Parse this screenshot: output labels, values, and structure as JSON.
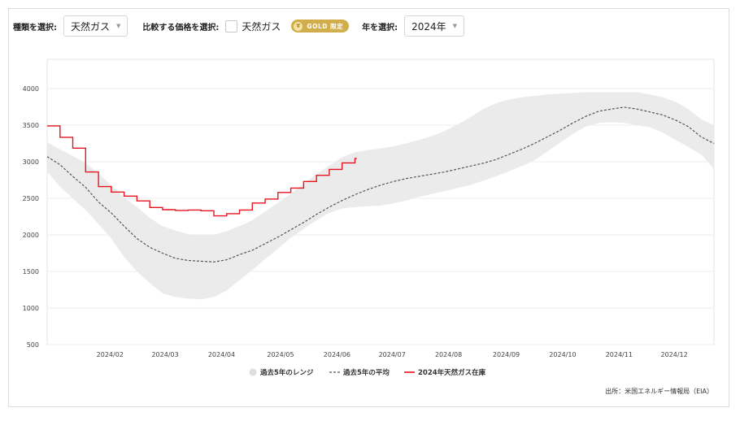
{
  "controls": {
    "type_label": "種類を選択:",
    "type_value": "天然ガス",
    "compare_label": "比較する価格を選択:",
    "compare_option": "天然ガス",
    "gold_badge": "GOLD 限定",
    "year_label": "年を選択:",
    "year_value": "2024年"
  },
  "source": "出所：米国エネルギー情報局（EIA）",
  "colors": {
    "inventory": "#e8141e",
    "average": "#555555",
    "range": "#ebebeb",
    "gold": "#d1ad4b"
  },
  "chart_data": {
    "type": "line",
    "title": "",
    "xlabel": "",
    "ylabel": "",
    "ylim": [
      500,
      4400
    ],
    "xlim": [
      1,
      53
    ],
    "yticks": [
      500,
      1000,
      1500,
      2000,
      2500,
      3000,
      3500,
      4000
    ],
    "xticks": [
      {
        "label": "2024/02",
        "x": 5.9
      },
      {
        "label": "2024/03",
        "x": 10.2
      },
      {
        "label": "2024/04",
        "x": 14.6
      },
      {
        "label": "2024/05",
        "x": 19.2
      },
      {
        "label": "2024/06",
        "x": 23.6
      },
      {
        "label": "2024/07",
        "x": 27.9
      },
      {
        "label": "2024/08",
        "x": 32.3
      },
      {
        "label": "2024/09",
        "x": 36.8
      },
      {
        "label": "2024/10",
        "x": 41.2
      },
      {
        "label": "2024/11",
        "x": 45.6
      },
      {
        "label": "2024/12",
        "x": 49.9
      }
    ],
    "grid": true,
    "legend_position": "bottom",
    "legend": [
      "過去5年のレンジ",
      "過去5年の平均",
      "2024年天然ガス在庫"
    ],
    "series": [
      {
        "name": "2024年天然ガス在庫",
        "style": "solid",
        "x": [
          1,
          2,
          3,
          4,
          5,
          6,
          7,
          8,
          9,
          10,
          11,
          12,
          13,
          14,
          15,
          16,
          17,
          18,
          19,
          20,
          21,
          22,
          23,
          24,
          25
        ],
        "values": [
          3490,
          3335,
          3185,
          2860,
          2660,
          2585,
          2530,
          2465,
          2375,
          2345,
          2335,
          2340,
          2330,
          2260,
          2290,
          2340,
          2435,
          2490,
          2580,
          2640,
          2730,
          2815,
          2895,
          2985,
          3045
        ]
      },
      {
        "name": "過去5年の平均",
        "style": "dashed",
        "x": [
          1,
          2,
          3,
          4,
          5,
          6,
          7,
          8,
          9,
          10,
          11,
          12,
          13,
          14,
          15,
          16,
          17,
          18,
          19,
          20,
          21,
          22,
          23,
          24,
          25,
          26,
          27,
          28,
          29,
          30,
          31,
          32,
          33,
          34,
          35,
          36,
          37,
          38,
          39,
          40,
          41,
          42,
          43,
          44,
          45,
          46,
          47,
          48,
          49,
          50,
          51,
          52,
          53
        ],
        "values": [
          3070,
          2960,
          2800,
          2650,
          2450,
          2300,
          2120,
          1950,
          1830,
          1750,
          1680,
          1650,
          1640,
          1630,
          1660,
          1730,
          1790,
          1880,
          1970,
          2070,
          2170,
          2280,
          2380,
          2470,
          2550,
          2620,
          2680,
          2730,
          2770,
          2800,
          2830,
          2860,
          2900,
          2940,
          2980,
          3030,
          3100,
          3170,
          3250,
          3340,
          3430,
          3530,
          3620,
          3690,
          3720,
          3745,
          3720,
          3680,
          3640,
          3570,
          3480,
          3340,
          3250
        ]
      },
      {
        "name": "過去5年のレンジ",
        "style": "band",
        "x": [
          1,
          2,
          3,
          4,
          5,
          6,
          7,
          8,
          9,
          10,
          11,
          12,
          13,
          14,
          15,
          16,
          17,
          18,
          19,
          20,
          21,
          22,
          23,
          24,
          25,
          26,
          27,
          28,
          29,
          30,
          31,
          32,
          33,
          34,
          35,
          36,
          37,
          38,
          39,
          40,
          41,
          42,
          43,
          44,
          45,
          46,
          47,
          48,
          49,
          50,
          51,
          52,
          53
        ],
        "low": [
          2870,
          2660,
          2500,
          2340,
          2150,
          1950,
          1700,
          1500,
          1340,
          1200,
          1150,
          1130,
          1120,
          1150,
          1240,
          1380,
          1520,
          1670,
          1810,
          1960,
          2080,
          2200,
          2300,
          2360,
          2380,
          2390,
          2400,
          2430,
          2470,
          2520,
          2560,
          2600,
          2640,
          2680,
          2740,
          2800,
          2870,
          2940,
          3020,
          3140,
          3260,
          3380,
          3480,
          3530,
          3540,
          3530,
          3500,
          3470,
          3400,
          3300,
          3200,
          3100,
          2900
        ],
        "high": [
          3270,
          3170,
          3080,
          2980,
          2840,
          2680,
          2510,
          2380,
          2230,
          2120,
          2060,
          2010,
          2000,
          2000,
          2050,
          2120,
          2200,
          2320,
          2440,
          2560,
          2700,
          2830,
          2950,
          3060,
          3130,
          3160,
          3180,
          3210,
          3250,
          3300,
          3350,
          3420,
          3510,
          3610,
          3720,
          3800,
          3850,
          3880,
          3900,
          3920,
          3930,
          3940,
          3950,
          3950,
          3950,
          3950,
          3950,
          3920,
          3880,
          3820,
          3720,
          3580,
          3500
        ]
      }
    ]
  }
}
